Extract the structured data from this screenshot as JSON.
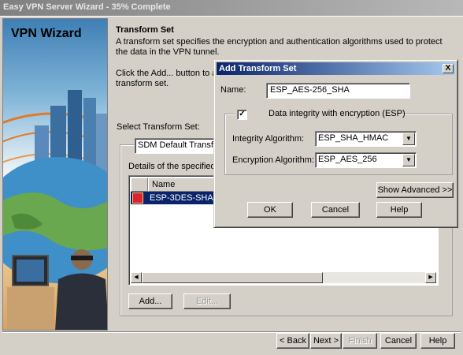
{
  "window": {
    "title": "Easy VPN Server Wizard - 35% Complete"
  },
  "art": {
    "title": "VPN Wizard"
  },
  "page": {
    "heading": "Transform Set",
    "description": "A transform set specifies the encryption and authentication algorithms used to protect the data in the VPN tunnel.",
    "click_add_line1": "Click the Add... button to ad",
    "click_add_line2": "transform set.",
    "select_label": "Select Transform Set:",
    "select_value": "SDM Default Transfo",
    "details_label": "Details of the specified",
    "table": {
      "column_name": "Name",
      "rows": [
        {
          "name": "ESP-3DES-SHA",
          "icon": "transform-set-icon"
        }
      ]
    },
    "add_button": "Add...",
    "edit_button": "Edit..."
  },
  "nav": {
    "back": "< Back",
    "next": "Next >",
    "finish": "Finish",
    "cancel": "Cancel",
    "help": "Help"
  },
  "dialog": {
    "title": "Add Transform Set",
    "close": "X",
    "name_label": "Name:",
    "name_value": "ESP_AES-256_SHA",
    "integrity_checkbox_label": "Data integrity with encryption (ESP)",
    "integrity_checked": true,
    "integrity_algo_label": "Integrity Algorithm:",
    "integrity_algo_value": "ESP_SHA_HMAC",
    "encryption_algo_label": "Encryption Algorithm:",
    "encryption_algo_value": "ESP_AES_256",
    "show_advanced": "Show Advanced >>",
    "ok": "OK",
    "cancel": "Cancel",
    "help": "Help"
  },
  "colors": {
    "selection": "#0a246a",
    "dialog_title_start": "#0a246a",
    "dialog_title_end": "#a6caf0",
    "window_face": "#d4d0c8"
  }
}
